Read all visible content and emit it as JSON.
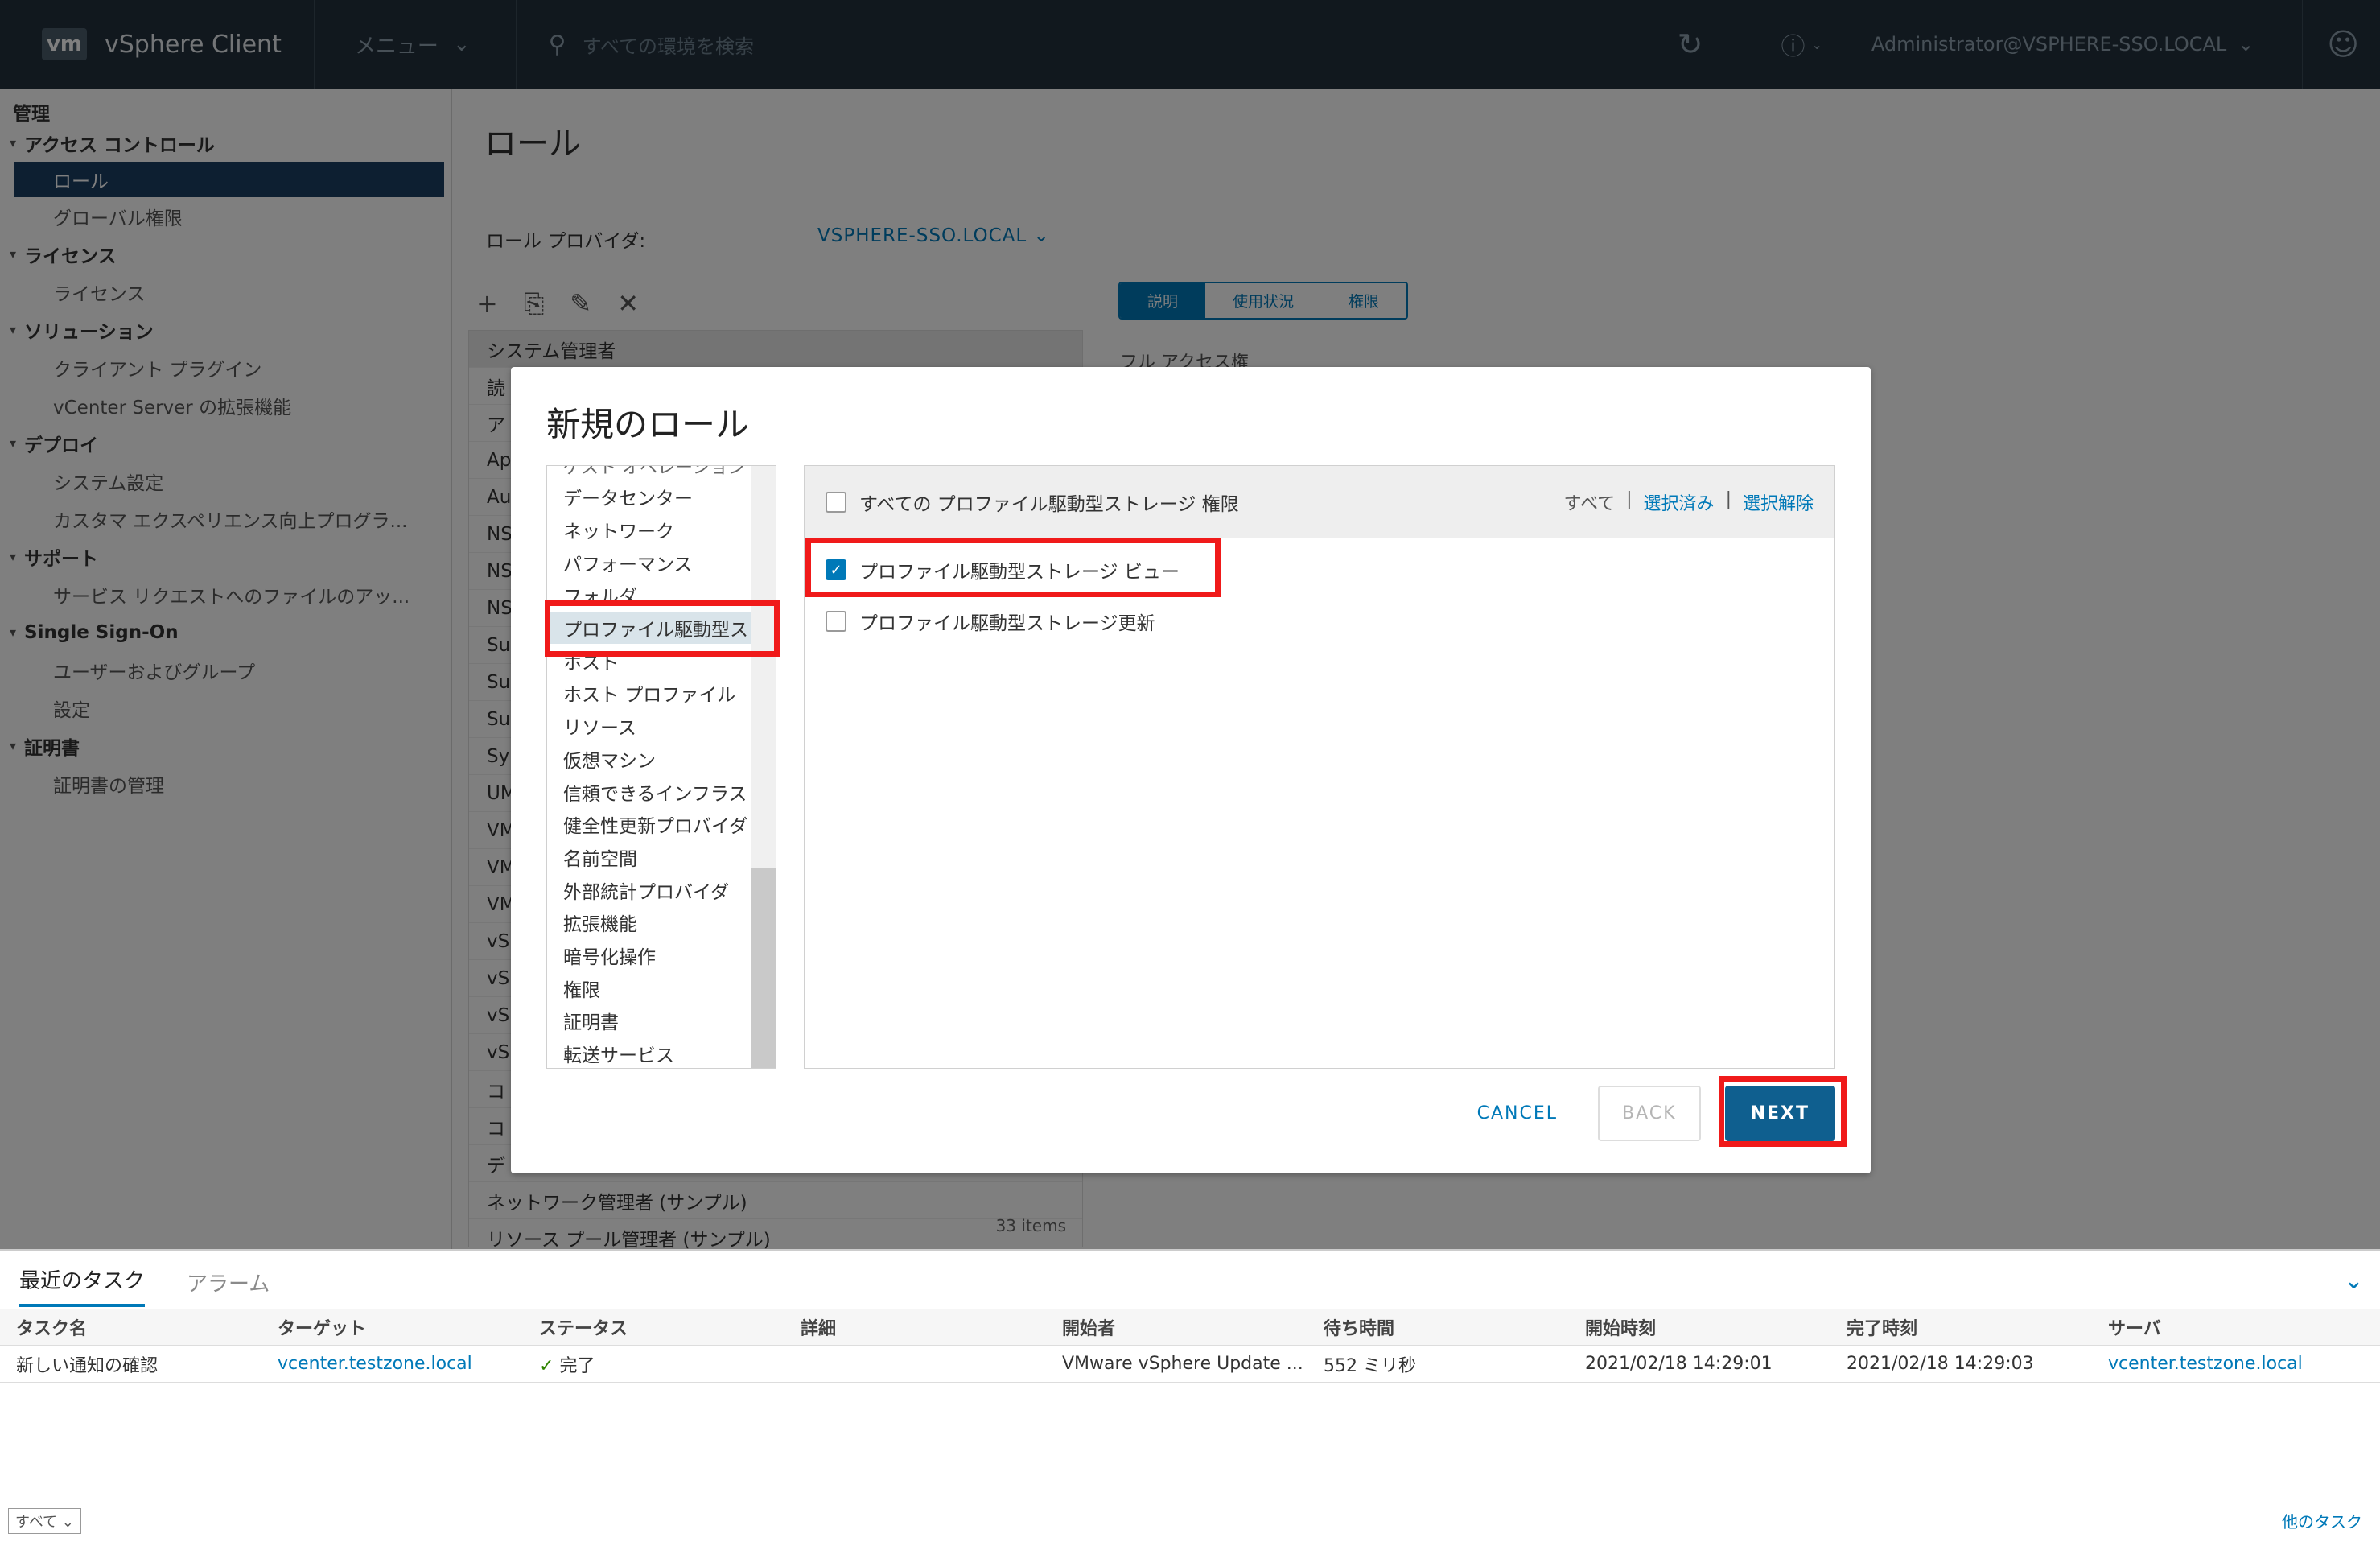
{
  "header": {
    "logo": "vm",
    "app_title": "vSphere Client",
    "menu_label": "メニュー",
    "search_placeholder": "すべての環境を検索",
    "user": "Administrator@VSPHERE-SSO.LOCAL"
  },
  "sidebar": {
    "title": "管理",
    "groups": [
      {
        "label": "アクセス コントロール",
        "items": [
          "ロール",
          "グローバル権限"
        ]
      },
      {
        "label": "ライセンス",
        "items": [
          "ライセンス"
        ]
      },
      {
        "label": "ソリューション",
        "items": [
          "クライアント プラグイン",
          "vCenter Server の拡張機能"
        ]
      },
      {
        "label": "デプロイ",
        "items": [
          "システム設定",
          "カスタマ エクスペリエンス向上プログラ..."
        ]
      },
      {
        "label": "サポート",
        "items": [
          "サービス リクエストへのファイルのアッ..."
        ]
      },
      {
        "label": "Single Sign-On",
        "items": [
          "ユーザーおよびグループ",
          "設定"
        ]
      },
      {
        "label": "証明書",
        "items": [
          "証明書の管理"
        ]
      }
    ],
    "active_item": "ロール"
  },
  "main": {
    "title": "ロール",
    "provider_label": "ロール プロバイダ:",
    "provider_value": "VSPHERE-SSO.LOCAL",
    "roles": [
      "システム管理者",
      "読",
      "ア",
      "Ap",
      "Au",
      "NS",
      "NS",
      "NS",
      "Su",
      "Su",
      "Su",
      "Sy",
      "UM",
      "VM",
      "VM",
      "VM",
      "vS",
      "vS",
      "vS",
      "vS",
      "コ",
      "コ",
      "デ",
      "ネットワーク管理者 (サンプル)",
      "リソース プール管理者 (サンプル)"
    ],
    "items_count": "33 items",
    "tabs": [
      "説明",
      "使用状況",
      "権限"
    ],
    "description": "フル アクセス権"
  },
  "modal": {
    "title": "新規のロール",
    "clipped_category": "ゲスト オペレーション",
    "categories": [
      "データセンター",
      "ネットワーク",
      "パフォーマンス",
      "フォルダ",
      "プロファイル駆動型スト...",
      "ホスト",
      "ホスト プロファイル",
      "リソース",
      "仮想マシン",
      "信頼できるインフラスト...",
      "健全性更新プロバイダ",
      "名前空間",
      "外部統計プロバイダ",
      "拡張機能",
      "暗号化操作",
      "権限",
      "証明書",
      "転送サービス"
    ],
    "selected_category": "プロファイル駆動型スト...",
    "all_privileges_label": "すべての プロファイル駆動型ストレージ 権限",
    "link_all": "すべて",
    "link_selected": "選択済み",
    "link_deselect": "選択解除",
    "privileges": [
      {
        "label": "プロファイル駆動型ストレージ ビュー",
        "checked": true
      },
      {
        "label": "プロファイル駆動型ストレージ更新",
        "checked": false
      }
    ],
    "cancel": "CANCEL",
    "back": "BACK",
    "next": "NEXT"
  },
  "tasks": {
    "tabs": [
      "最近のタスク",
      "アラーム"
    ],
    "columns": [
      "タスク名",
      "ターゲット",
      "ステータス",
      "詳細",
      "開始者",
      "待ち時間",
      "開始時刻",
      "完了時刻",
      "サーバ"
    ],
    "rows": [
      {
        "name": "新しい通知の確認",
        "target": "vcenter.testzone.local",
        "status": "完了",
        "details": "",
        "initiator": "VMware vSphere Update ...",
        "wait": "552 ミリ秒",
        "start": "2021/02/18 14:29:01",
        "end": "2021/02/18 14:29:03",
        "server": "vcenter.testzone.local"
      }
    ],
    "filter": "すべて",
    "more_tasks": "他のタスク"
  },
  "colors": {
    "header_bg": "#22303c",
    "accent": "#0079b8",
    "highlight": "#f01a1a"
  }
}
